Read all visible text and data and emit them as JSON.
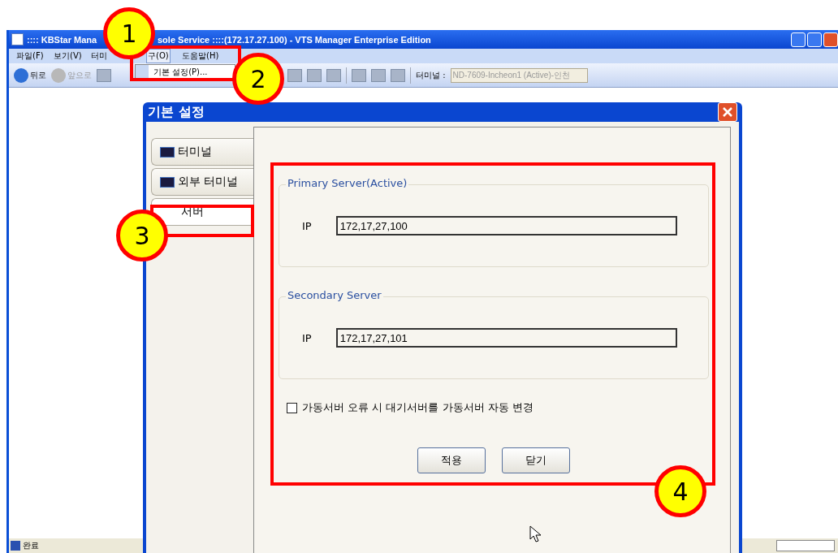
{
  "window": {
    "title_parts": [
      ":::: KBStar Mana",
      "sole Service ::::(172.17.27.100) - VTS Manager Enterprise Edition"
    ]
  },
  "menu": [
    {
      "label": "파일(F)",
      "selected": false
    },
    {
      "label": "보기(V)",
      "selected": false
    },
    {
      "label": "터미",
      "selected": false
    },
    {
      "label": "구(O)",
      "selected": true
    },
    {
      "label": "도움말(H)",
      "selected": false
    }
  ],
  "open_menu": {
    "items": [
      "기본 설정(P)..."
    ]
  },
  "toolbar": {
    "back": {
      "label": "뒤로",
      "disabled": false
    },
    "forward": {
      "label": "앞으로",
      "disabled": true
    },
    "terminal_label": "터미널 :",
    "terminal_value": "ND-7609-Incheon1 (Active)-인천"
  },
  "status_bar": {
    "text": "완료"
  },
  "dialog": {
    "title": "기본 설정",
    "tabs": [
      {
        "label": "터미널",
        "selected": false,
        "has_icon": true
      },
      {
        "label": "외부 터미널",
        "selected": false,
        "has_icon": true
      },
      {
        "label": "서버",
        "selected": true,
        "has_icon": false
      }
    ],
    "groups": [
      {
        "title": "Primary Server(Active)",
        "field_label": "IP",
        "value": "172,17,27,100"
      },
      {
        "title": "Secondary Server",
        "field_label": "IP",
        "value": "172,17,27,101"
      }
    ],
    "checkbox": {
      "label": "가동서버 오류 시 대기서버를 가동서버 자동 변경",
      "checked": false
    },
    "buttons": [
      "적용",
      "닫기"
    ]
  },
  "annotations": [
    {
      "label": "1"
    },
    {
      "label": "2"
    },
    {
      "label": "3"
    },
    {
      "label": "4"
    }
  ]
}
